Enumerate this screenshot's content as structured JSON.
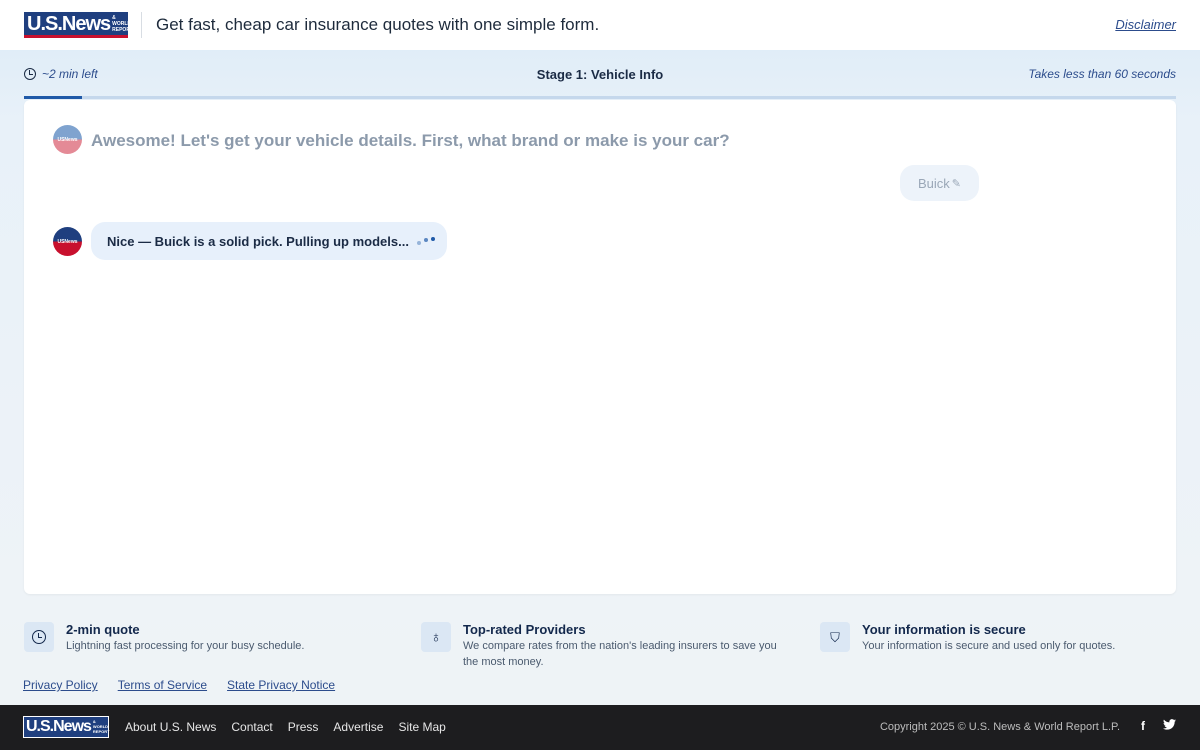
{
  "header": {
    "logo_text": "U.S.News",
    "logo_subtext": "& WORLD REPORT",
    "tagline": "Get fast, cheap car insurance quotes with one simple form.",
    "disclaimer": "Disclaimer"
  },
  "progress": {
    "time_left": "~2 min left",
    "stage_title": "Stage 1: Vehicle Info",
    "takes_less": "Takes less than 60 seconds",
    "fraction": 0.05
  },
  "chat": {
    "avatar_text": "USNews",
    "question": "Awesome! Let's get your vehicle details. First, what brand or make is your car?",
    "user_answer": "Buick",
    "bot_reply": "Nice — Buick is a solid pick. Pulling up models..."
  },
  "features": [
    {
      "title": "2-min quote",
      "desc": "Lightning fast processing for your busy schedule."
    },
    {
      "title": "Top-rated Providers",
      "desc": "We compare rates from the nation's leading insurers to save you the most money."
    },
    {
      "title": "Your information is secure",
      "desc": "Your information is secure and used only for quotes."
    }
  ],
  "legal_links": [
    "Privacy Policy",
    "Terms of Service",
    "State Privacy Notice"
  ],
  "footer": {
    "nav": [
      "About U.S. News",
      "Contact",
      "Press",
      "Advertise",
      "Site Map"
    ],
    "copyright": "Copyright 2025 © U.S. News & World Report L.P.",
    "social": [
      "f",
      "t"
    ]
  },
  "colors": {
    "brand_blue": "#1f3f7f",
    "brand_red": "#c8102e",
    "progress_fill": "#1f5aa8"
  }
}
